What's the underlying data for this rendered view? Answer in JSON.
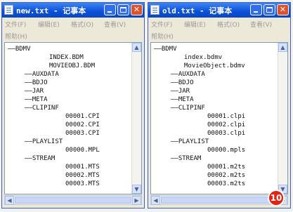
{
  "windows": [
    {
      "title": "new.txt - 记事本",
      "menu": [
        "文件(F)",
        "编辑(E)",
        "格式(O)",
        "查看(V)"
      ],
      "help": "帮助(H)",
      "lines": [
        "——BDMV",
        "INDEX.BDM",
        "MOVIEOBJ.BDM",
        "——AUXDATA",
        "——BDJO",
        "——JAR",
        "——META",
        "——CLIPINF",
        "00001.CPI",
        "00002.CPI",
        "00003.CPI",
        "——PLAYLIST",
        "00000.MPL",
        "——STREAM",
        "00001.MTS",
        "00002.MTS",
        "00003.MTS"
      ]
    },
    {
      "title": "old.txt - 记事本",
      "menu": [
        "文件(F)",
        "编辑(E)",
        "格式(O)",
        "查看(V)"
      ],
      "help": "帮助(H)",
      "lines": [
        "——BDMV",
        "index.bdmv",
        "MovieObject.bdmv",
        "——AUXDATA",
        "——BDJO",
        "——JAR",
        "——META",
        "——CLIPINF",
        "00001.clpi",
        "00002.clpi",
        "00003.clpi",
        "——PLAYLIST",
        "00000.mpls",
        "——STREAM",
        "00001.m2ts",
        "00002.m2ts",
        "00003.m2ts"
      ]
    }
  ],
  "step_badge": "10",
  "colors": {
    "titlebar": "#0a4fd8",
    "badge": "#e4220f"
  }
}
